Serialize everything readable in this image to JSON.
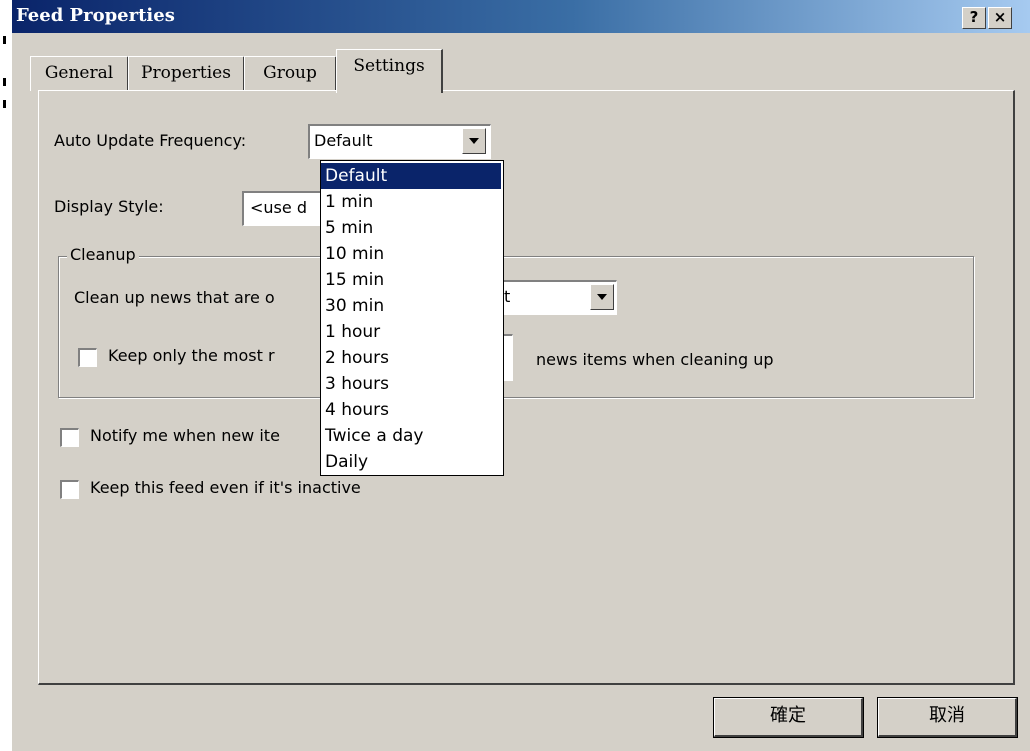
{
  "window": {
    "title": "Feed Properties",
    "help_button": "?",
    "close_button": "×"
  },
  "tabs": [
    {
      "label": "General"
    },
    {
      "label": "Properties"
    },
    {
      "label": "Group"
    },
    {
      "label": "Settings",
      "active": true
    }
  ],
  "settings": {
    "auto_update_label": "Auto Update Frequency:",
    "auto_update_value": "Default",
    "display_style_label": "Display Style:",
    "display_style_value": "<use d",
    "cleanup_legend": "Cleanup",
    "cleanup_label": "Clean up news that are o",
    "cleanup_value": "t",
    "keep_most_label": "Keep only the most r",
    "keep_most_suffix": "news items when cleaning up",
    "notify_label": "Notify me when new ite",
    "keep_inactive_label": "Keep this feed even if it's inactive"
  },
  "dropdown": {
    "options": [
      "Default",
      "1 min",
      "5 min",
      "10 min",
      "15 min",
      "30 min",
      "1 hour",
      "2 hours",
      "3 hours",
      "4 hours",
      "Twice a day",
      "Daily"
    ],
    "selected": "Default"
  },
  "buttons": {
    "ok": "確定",
    "cancel": "取消"
  },
  "colors": {
    "selection": "#0a246a",
    "face": "#d4d0c8"
  }
}
